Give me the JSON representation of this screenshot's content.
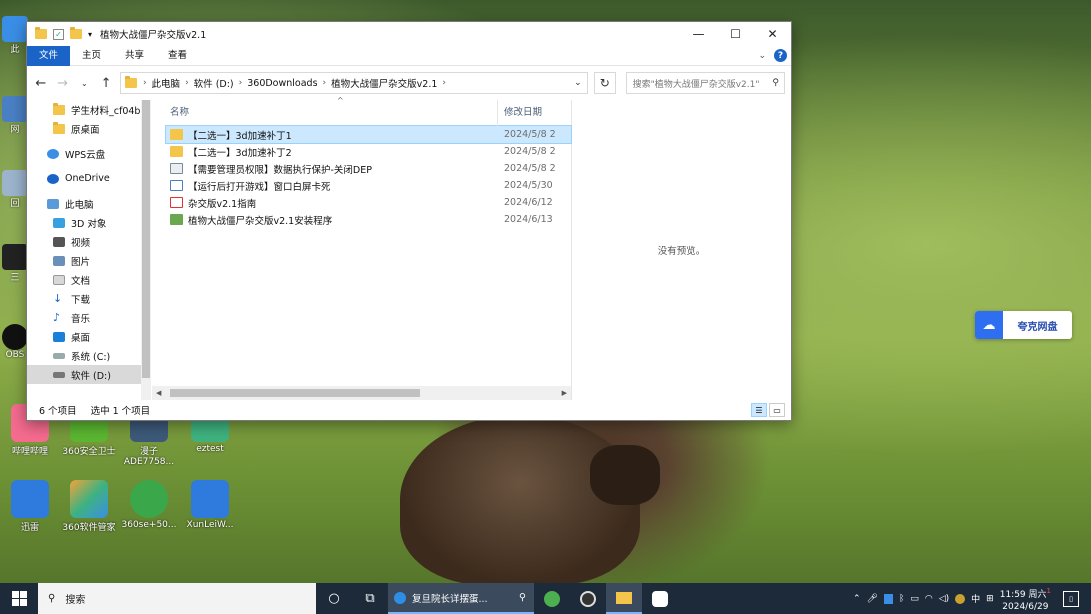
{
  "window": {
    "title": "植物大战僵尸杂交版v2.1",
    "ribbon_tabs": [
      "文件",
      "主页",
      "共享",
      "查看"
    ],
    "address": [
      "此电脑",
      "软件 (D:)",
      "360Downloads",
      "植物大战僵尸杂交版v2.1"
    ],
    "search_placeholder": "搜索\"植物大战僵尸杂交版v2.1\"",
    "nav_items": [
      {
        "label": "学生材料_cf04b",
        "icon": "folder-icon"
      },
      {
        "label": "原桌面",
        "icon": "folder-icon"
      },
      {
        "label": "WPS云盘",
        "icon": "cloud-icon"
      },
      {
        "label": "OneDrive",
        "icon": "cloud-icon"
      },
      {
        "label": "此电脑",
        "icon": "pc-icon"
      },
      {
        "label": "3D 对象",
        "icon": "cube-icon"
      },
      {
        "label": "视频",
        "icon": "video-icon"
      },
      {
        "label": "图片",
        "icon": "picture-icon"
      },
      {
        "label": "文档",
        "icon": "document-icon"
      },
      {
        "label": "下载",
        "icon": "download-icon"
      },
      {
        "label": "音乐",
        "icon": "music-icon"
      },
      {
        "label": "桌面",
        "icon": "desktop-icon"
      },
      {
        "label": "系统 (C:)",
        "icon": "drive-icon"
      },
      {
        "label": "软件 (D:)",
        "icon": "drive-icon"
      }
    ],
    "columns": {
      "name": "名称",
      "date": "修改日期"
    },
    "files": [
      {
        "name": "【二选一】3d加速补丁1",
        "date": "2024/5/8 2",
        "type": "folder"
      },
      {
        "name": "【二选一】3d加速补丁2",
        "date": "2024/5/8 2",
        "type": "folder"
      },
      {
        "name": "【需要管理员权限】数据执行保护-关闭DEP",
        "date": "2024/5/8 2",
        "type": "file"
      },
      {
        "name": "【运行后打开游戏】窗口白屏卡死",
        "date": "2024/5/30",
        "type": "app"
      },
      {
        "name": "杂交版v2.1指南",
        "date": "2024/6/12",
        "type": "pdf"
      },
      {
        "name": "植物大战僵尸杂交版v2.1安装程序",
        "date": "2024/6/13",
        "type": "installer"
      }
    ],
    "preview_text": "没有预览。",
    "status_count": "6 个项目",
    "status_selected": "选中 1 个项目"
  },
  "desktop_icons": [
    {
      "label": "哔哩哔哩",
      "color": "#f46b8e"
    },
    {
      "label": "360安全卫士",
      "color": "#5bb631"
    },
    {
      "label": "漫子\nADE7758...",
      "color": "#3d5a7a"
    },
    {
      "label": "eztest",
      "color": "#3fb27f"
    },
    {
      "label": "迅雷",
      "color": "#2e7bdd"
    },
    {
      "label": "360软件管家",
      "color": "#f4a23a"
    },
    {
      "label": "360se+50...",
      "color": "#3aa84a"
    },
    {
      "label": "XunLeiW...",
      "color": "#2e7bdd"
    }
  ],
  "left_edge_labels": [
    "此",
    "网",
    "回",
    "三",
    "OBS"
  ],
  "netdisk": {
    "label": "夸克网盘"
  },
  "taskbar": {
    "search": "搜索",
    "task_label": "复旦院长详摆蛋...",
    "ime": "中",
    "time": "11:59 周六",
    "date": "2024/6/29",
    "badge": "1"
  }
}
